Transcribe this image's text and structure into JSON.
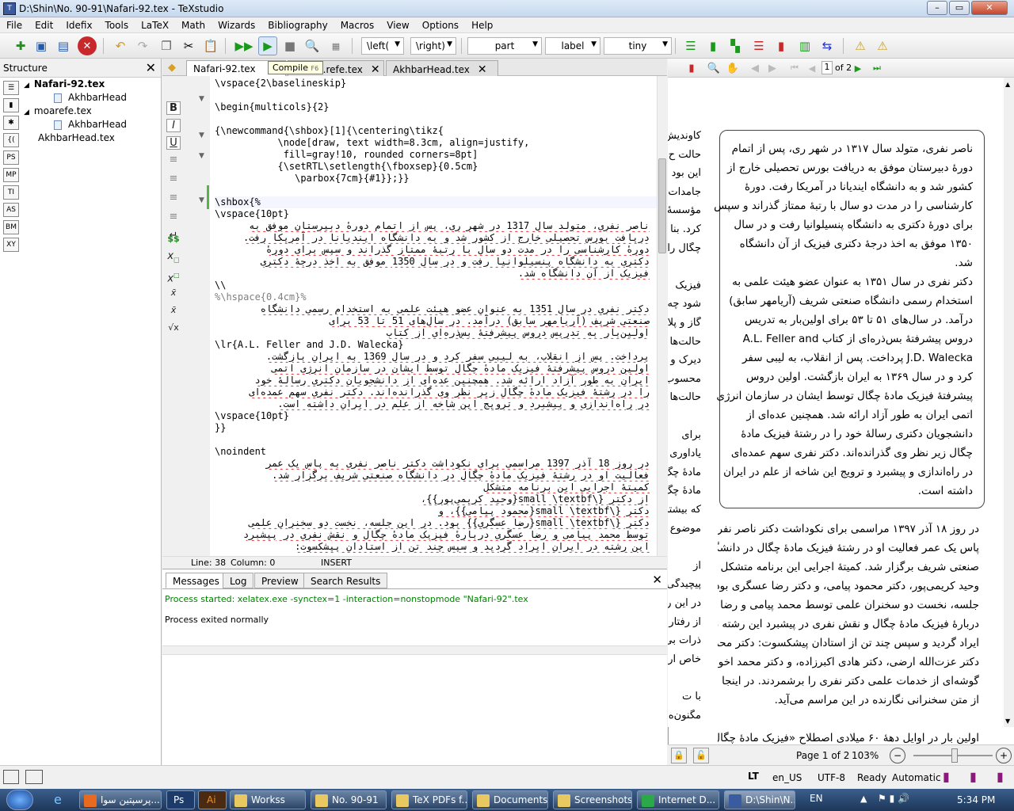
{
  "window": {
    "title": "D:\\Shin\\No. 90-91\\Nafari-92.tex - TeXstudio",
    "app_icon": "texstudio-icon"
  },
  "menu": [
    "File",
    "Edit",
    "Idefix",
    "Tools",
    "LaTeX",
    "Math",
    "Wizards",
    "Bibliography",
    "Macros",
    "View",
    "Options",
    "Help"
  ],
  "toolbar": {
    "left_delim": "\\left(",
    "right_delim": "\\right)",
    "sectioning": "part",
    "reference": "label",
    "size": "tiny"
  },
  "structure": {
    "title": "Structure",
    "side_buttons": [
      "MP",
      "TI",
      "AS",
      "BM",
      "XY"
    ],
    "tree": [
      {
        "label": "Nafari-92.tex",
        "bold": true,
        "level": 0
      },
      {
        "label": "AkhbarHead",
        "level": 1
      },
      {
        "label": "moarefe.tex",
        "level": 0
      },
      {
        "label": "AkhbarHead",
        "level": 1
      },
      {
        "label": "AkhbarHead.tex",
        "level": 0
      }
    ]
  },
  "tabs": [
    {
      "label": "Nafari-92.tex",
      "active": true
    },
    {
      "label": "...refe.tex",
      "active": false
    },
    {
      "label": "AkhbarHead.tex",
      "active": false
    }
  ],
  "tooltip": "Compile",
  "tooltip_key": "F6",
  "editor": {
    "lines": [
      "\\vspace{2\\baselineskip}",
      "",
      "\\begin{multicols}{2}",
      "",
      "{\\newcommand{\\shbox}[1]{\\centering\\tikz{",
      "           \\node[draw, text width=8.3cm, align=justify,",
      "            fill=gray!10, rounded corners=8pt]",
      "           {\\setRTL\\setlength{\\fboxsep}{0.5cm}",
      "              \\parbox{7cm}{#1}};}}",
      "",
      "",
      "\\shbox{%",
      "\\vspace{10pt}"
    ],
    "rtl1": [
      "ناصر نفری، متولد سال 1317 در شهر ری، پس از اتمام دورهٔ دبیرستان موفق به",
      "دریافت بورس تحصیلی خارج از کشور شد و به دانشگاه ایندیانا در آمریکا رفت.",
      "دورهٔ کارشناسی را در مدت دو سال با رتبهٔ ممتاز گذراند و سپس برای دورهٔ",
      "دکتری به دانشگاه پنسیلوانیا رفت و در سال 1350 موفق به اخذ درجهٔ دکتری",
      "فیزیک از آن دانشگاه شد."
    ],
    "break1": "\\\\",
    "comment1": "%\\hspace{0.4cm}%",
    "rtl2": [
      "دکتر نفری در سال 1351 به عنوان عضو هیئت علمی به استخدام رسمی دانشگاه",
      "صنعتی شریف (آریامهر سابق) درآمد. در سال‌های 51 تا 53 برای",
      "اولین‌بار به تدریس دروس پیشرفتهٔ بس‌ذره‌ای از کتاب"
    ],
    "lr_line": "\\lr{A.L. Feller and J.D. Walecka}",
    "rtl3": [
      "پرداخت. پس از انقلاب، به لیبی سفر کرد و در سال 1369 به ایران بازگشت.",
      "اولین دروس پیشرفتهٔ فیزیک مادهٔ چگال توسط ایشان در سازمان انرژی اتمی",
      "ایران به طور آزاد ارائه شد. همچنین عده‌ای از دانشجویان دکتری رسالهٔ خود",
      "را در رشتهٔ فیزیک مادهٔ چگال زیر نظر وی گذرانده‌اند. دکتر نفری سهم عمده‌ای",
      "در راه‌اندازی و پیشبرد و ترویج این شاخه از علم در ایران داشته است."
    ],
    "after": [
      "\\vspace{10pt}",
      "}}",
      "",
      "\\noindent"
    ],
    "rtl4": [
      "در روز 18 آذر 1397 مراسمی برای نکوداشت دکتر ناصر نفری به پاس یک عمر",
      "فعالیت او در رشتهٔ فیزیک مادهٔ چگال در دانشگاه صنعتی شریف برگزار شد.",
      "کمیتهٔ اجرایی این برنامه متشکل",
      "از دکتر {\\small \\textbf{وحید کریمی‌پور}}،",
      "دکتر {\\small \\textbf{محمود پیامی}}، و",
      "دکتر {\\small \\textbf{رضا عسگری}} بود. در این جلسه، نخست دو سخنران علمی",
      "توسط محمد پیامی و رضا عسگری دربارهٔ فیزیک مادهٔ چگال و نقش نفری در پیشبرد",
      "این رشته در ایران ایراد گردید و سپس چند تن از استادان پیشکسوت:"
    ]
  },
  "editor_status": {
    "line": "Line: 38",
    "column": "Column: 0",
    "mode": "INSERT"
  },
  "messages": {
    "tabs": [
      "Messages",
      "Log",
      "Preview",
      "Search Results"
    ],
    "started": "Process started: xelatex.exe -synctex=1 -interaction=nonstopmode \"Nafari-92\".tex",
    "exited": "Process exited normally"
  },
  "pdf": {
    "page_current": "1",
    "page_of": "of 2",
    "left_column": [
      "کاوندیش",
      "حالت ح",
      "این بود",
      "جامدات",
      "مؤسسهٔ",
      "کرد. بنا",
      "چگال را",
      "",
      "فیزیک",
      "شود چه",
      "گاز و پلا",
      "حالت‌ها",
      "دیرک و",
      "محسوب",
      "حالت‌ها",
      "",
      "برای",
      "یادآوری",
      "مادهٔ چگ",
      "مادهٔ چگ",
      "که بیشتر",
      "موضوع",
      "",
      "از",
      "پیچیدگی",
      "در این ر",
      "از رفتار",
      "ذرات بی",
      "خاص ار",
      "",
      "با ت",
      "مگنون‌ه",
      "بیولوژی",
      "شیمی م",
      "مادهٔ چگ"
    ],
    "box_lines": [
      "ناصر نفری، متولد سال ۱۳۱۷ در شهر ری، پس از اتمام",
      "دورهٔ دبیرستان موفق به دریافت بورس تحصیلی خارج از",
      "کشور شد و به دانشگاه ایندیانا در آمریکا رفت. دورهٔ",
      "کارشناسی را در مدت دو سال با رتبهٔ ممتاز گذراند و سپس",
      "برای دورهٔ دکتری به دانشگاه پنسیلوانیا رفت و در سال",
      "۱۳۵۰ موفق به اخذ درجهٔ دکتری فیزیک از آن دانشگاه",
      "شد.",
      "دکتر نفری در سال ۱۳۵۱ به عنوان عضو هیئت علمی به",
      "استخدام رسمی دانشگاه صنعتی شریف (آریامهر سابق)",
      "درآمد. در سال‌های ۵۱ تا ۵۳ برای اولین‌بار به تدریس",
      "دروس پیشرفتهٔ بس‌ذره‌ای از کتاب A.L. Feller and",
      "J.D. Walecka پرداخت. پس از انقلاب، به لیبی سفر",
      "کرد و در سال ۱۳۶۹ به ایران بازگشت. اولین دروس",
      "پیشرفتهٔ فیزیک مادهٔ چگال توسط ایشان در سازمان انرژی",
      "اتمی ایران به طور آزاد ارائه شد. همچنین عده‌ای از",
      "دانشجویان دکتری رسالهٔ خود را در رشتهٔ فیزیک مادهٔ",
      "چگال زیر نظر وی گذرانده‌اند. دکتر نفری سهم عمده‌ای",
      "در راه‌اندازی و پیشبرد و ترویج این شاخه از علم در ایران",
      "داشته است."
    ],
    "body_lines": [
      "در روز ۱۸ آذر ۱۳۹۷ مراسمی برای نکوداشت دکتر ناصر نفری به",
      "پاس یک عمر فعالیت او در رشتهٔ فیزیک مادهٔ چگال در دانشگاه",
      "صنعتی شریف برگزار شد. کمیتهٔ اجرایی این برنامه متشکل از دکتر",
      "وحید کریمی‌پور، دکتر محمود پیامی، و دکتر رضا عسگری بود. در این",
      "جلسه، نخست دو سخنران علمی توسط محمد پیامی و رضا عسگری",
      "دربارهٔ فیزیک مادهٔ چگال و نقش نفری در پیشبرد این رشته در ایران",
      "ایراد گردید و سپس چند تن از استادان پیشکسوت: دکتر محمد امینی،",
      "دکتر عزت‌الله ارضی، دکتر هادی اکبرزاده، و دکتر محمد اخوان، هر یک",
      "گوشه‌ای از خدمات علمی دکتر نفری را برشمردند. در اینجا خلاصه‌ای",
      "از متن سخنرانی نگارنده در این مراسم می‌آید.",
      "",
      "اولین بار در اوایل دههٔ ۶۰ میلادی اصطلاح «فیزیک مادهٔ چگال»"
    ],
    "page_label": "Page 1 of 2",
    "zoom": "103%"
  },
  "status": {
    "language": "en_US",
    "encoding": "UTF-8",
    "state": "Ready",
    "mode": "Automatic"
  },
  "taskbar": {
    "items": [
      "پرسپتین سوا...",
      "Ps",
      "Ai",
      "Workss",
      "No. 90-91",
      "TeX PDFs f...",
      "Documents",
      "Screenshots",
      "Internet D...",
      "D:\\Shin\\N..."
    ],
    "lang": "EN",
    "time": "5:34 PM"
  },
  "colors": {
    "command": "#000080",
    "brace": "#008000",
    "comment": "#808080",
    "message_green": "#008000",
    "spell_error": "#dd3333"
  }
}
